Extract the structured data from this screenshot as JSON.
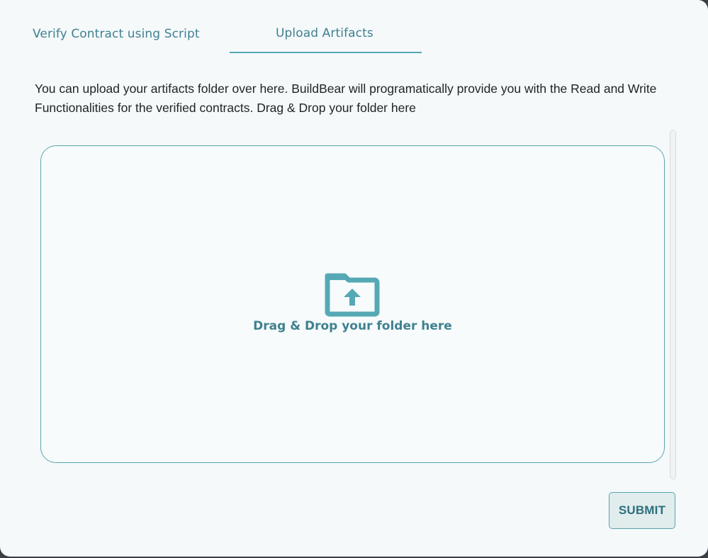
{
  "tabs": [
    {
      "label": "Verify Contract using Script",
      "active": false
    },
    {
      "label": "Upload Artifacts",
      "active": true
    }
  ],
  "description": "You can upload your artifacts folder over here. BuildBear will programatically provide you with the Read and Write Functionalities for the verified contracts. Drag & Drop your folder here",
  "dropzone": {
    "icon": "folder-upload-icon",
    "label": "Drag & Drop your folder here"
  },
  "submit_label": "SUBMIT",
  "colors": {
    "accent": "#58a7b2",
    "tab_text": "#3f8190",
    "background": "#f5f9fa"
  }
}
